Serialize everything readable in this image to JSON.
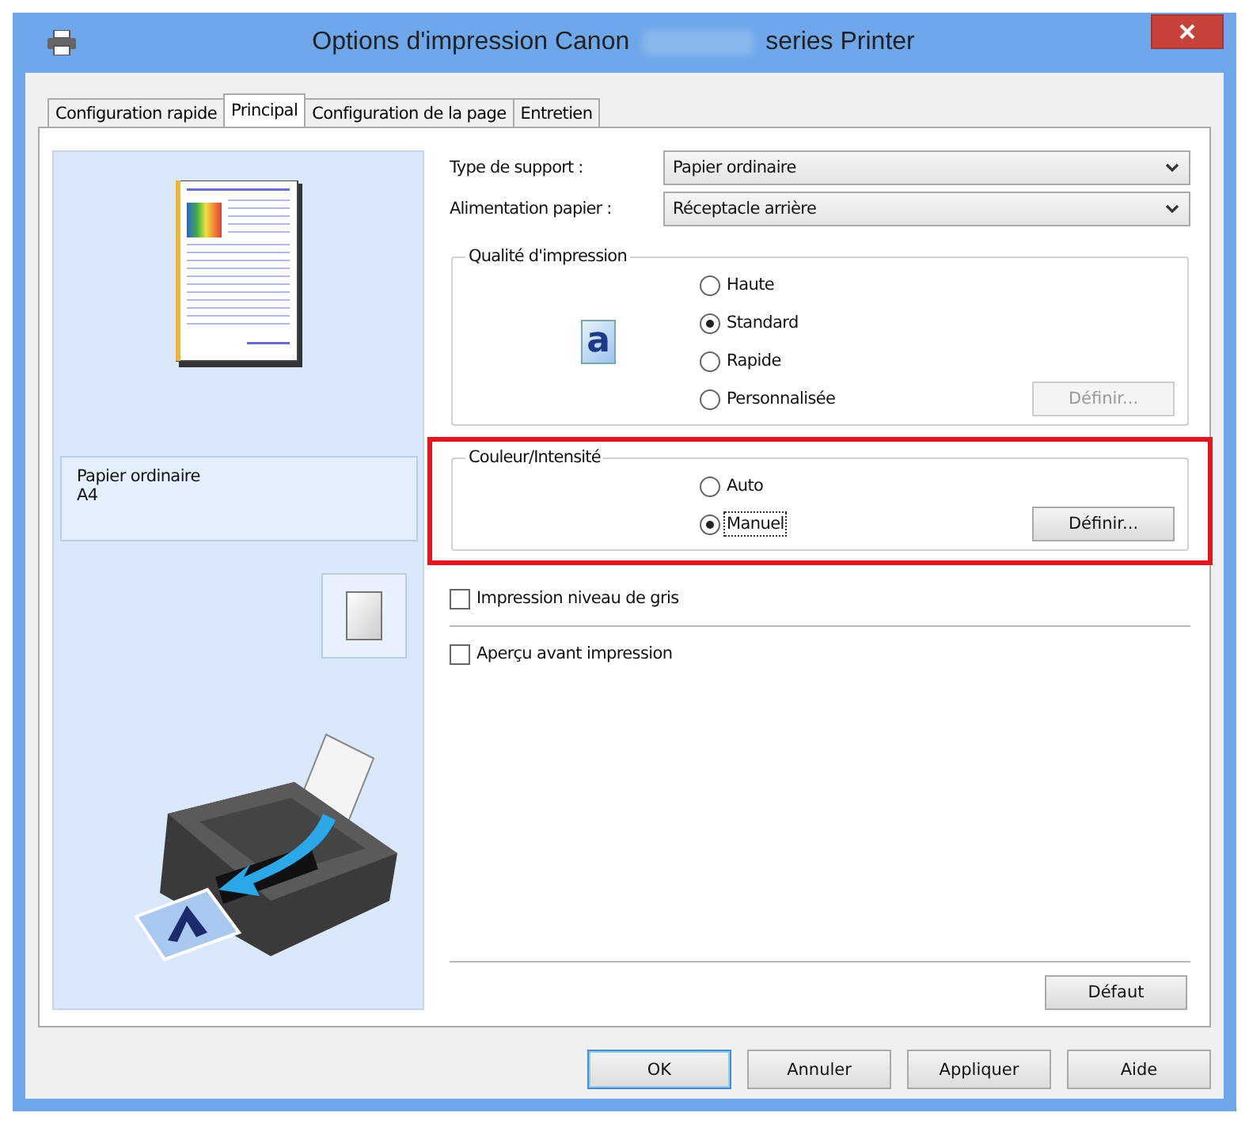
{
  "window": {
    "title_start": "Options d'impression Canon",
    "title_end": "series Printer"
  },
  "tabs": [
    {
      "label": "Configuration rapide",
      "selected": false
    },
    {
      "label": "Principal",
      "selected": true
    },
    {
      "label": "Configuration de la page",
      "selected": false
    },
    {
      "label": "Entretien",
      "selected": false
    }
  ],
  "preview": {
    "media": "Papier ordinaire",
    "size": "A4"
  },
  "fields": [
    {
      "label": "Type de support :",
      "value": "Papier ordinaire"
    },
    {
      "label": "Alimentation papier :",
      "value": "Réceptacle arrière"
    }
  ],
  "groups": [
    {
      "title": "Qualité d'impression",
      "highlighted": false,
      "icon_letter": "a",
      "options": [
        {
          "label": "Haute",
          "selected": false,
          "focused": false
        },
        {
          "label": "Standard",
          "selected": true,
          "focused": false
        },
        {
          "label": "Rapide",
          "selected": false,
          "focused": false
        },
        {
          "label": "Personnalisée",
          "selected": false,
          "focused": false
        }
      ],
      "button": {
        "label": "Définir...",
        "disabled": true
      }
    },
    {
      "title": "Couleur/Intensité",
      "highlighted": true,
      "options": [
        {
          "label": "Auto",
          "selected": false,
          "focused": false
        },
        {
          "label": "Manuel",
          "selected": true,
          "focused": true
        }
      ],
      "button": {
        "label": "Définir...",
        "disabled": false
      }
    }
  ],
  "checkboxes": [
    {
      "label": "Impression niveau de gris",
      "checked": false
    },
    {
      "label": "Aperçu avant impression",
      "checked": false
    }
  ],
  "default_button": "Défaut",
  "buttons": [
    {
      "label": "OK",
      "default": true
    },
    {
      "label": "Annuler",
      "default": false
    },
    {
      "label": "Appliquer",
      "default": false
    },
    {
      "label": "Aide",
      "default": false
    }
  ]
}
